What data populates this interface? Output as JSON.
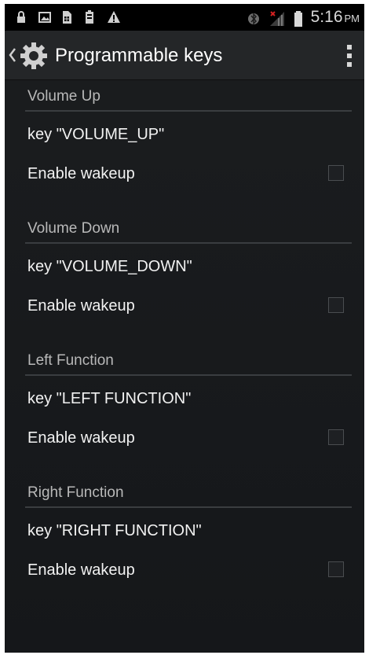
{
  "status_bar": {
    "time": "5:16",
    "ampm": "PM",
    "left_icons": [
      "lock-icon",
      "image-icon",
      "sim-card-icon",
      "battery-saver-icon",
      "warning-icon"
    ],
    "right_icons": [
      "bluetooth-icon",
      "no-signal-icon",
      "battery-icon"
    ]
  },
  "action_bar": {
    "title": "Programmable keys",
    "back_icon": "chevron-left-icon",
    "app_icon": "gear-icon",
    "menu_icon": "overflow-menu-icon"
  },
  "sections": [
    {
      "category": "Volume Up",
      "key_label": "key \"VOLUME_UP\"",
      "wakeup_label": "Enable wakeup",
      "wakeup_checked": false
    },
    {
      "category": "Volume Down",
      "key_label": "key \"VOLUME_DOWN\"",
      "wakeup_label": "Enable wakeup",
      "wakeup_checked": false
    },
    {
      "category": "Left Function",
      "key_label": "key \"LEFT FUNCTION\"",
      "wakeup_label": "Enable wakeup",
      "wakeup_checked": false
    },
    {
      "category": "Right Function",
      "key_label": "key \"RIGHT FUNCTION\"",
      "wakeup_label": "Enable wakeup",
      "wakeup_checked": false
    }
  ]
}
